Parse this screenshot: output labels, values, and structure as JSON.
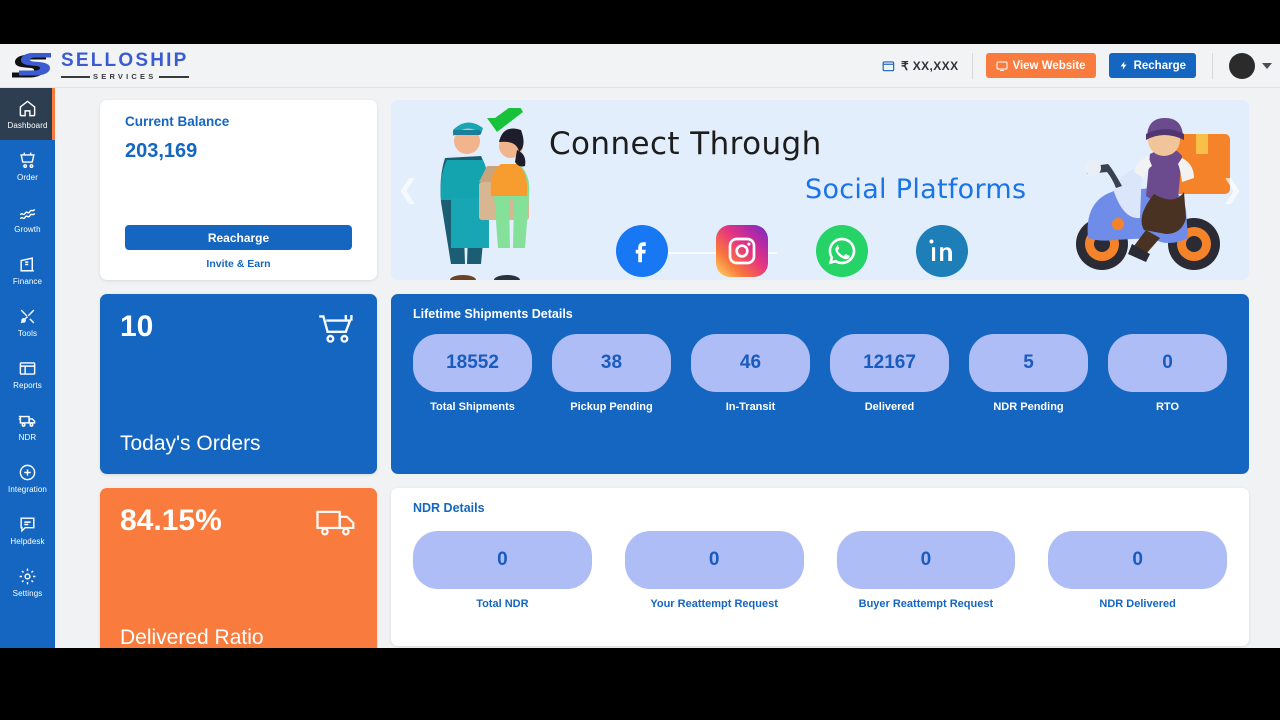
{
  "header": {
    "logo_name": "SELLOSHIP",
    "logo_sub": "SERVICES",
    "wallet_amount": "₹ XX,XXX",
    "view_website_label": "View Website",
    "recharge_label": "Recharge"
  },
  "sidebar": {
    "items": [
      {
        "label": "Dashboard",
        "icon": "home-icon",
        "active": true
      },
      {
        "label": "Order",
        "icon": "cart-icon",
        "active": false
      },
      {
        "label": "Growth",
        "icon": "growth-icon",
        "active": false
      },
      {
        "label": "Finance",
        "icon": "finance-icon",
        "active": false
      },
      {
        "label": "Tools",
        "icon": "tools-icon",
        "active": false
      },
      {
        "label": "Reports",
        "icon": "reports-icon",
        "active": false
      },
      {
        "label": "NDR",
        "icon": "truck-icon",
        "active": false
      },
      {
        "label": "Integration",
        "icon": "plus-circle-icon",
        "active": false
      },
      {
        "label": "Helpdesk",
        "icon": "chat-icon",
        "active": false
      },
      {
        "label": "Settings",
        "icon": "gear-icon",
        "active": false
      }
    ]
  },
  "balance": {
    "title": "Current Balance",
    "amount": "203,169",
    "recharge_label": "Reacharge",
    "invite_label": "Invite & Earn"
  },
  "banner": {
    "title": "Connect Through",
    "subtitle": "Social Platforms",
    "prev_icon": "chevron-left-icon",
    "next_icon": "chevron-right-icon",
    "socials": [
      "facebook-icon",
      "instagram-icon",
      "whatsapp-icon",
      "linkedin-icon"
    ]
  },
  "todays_orders": {
    "value": "10",
    "label": "Today's Orders",
    "icon": "cart-icon"
  },
  "delivered_ratio": {
    "value": "84.15%",
    "label": "Delivered Ratio",
    "icon": "truck-icon"
  },
  "lifetime_shipments": {
    "title": "Lifetime Shipments Details",
    "stats": [
      {
        "value": "18552",
        "label": "Total Shipments"
      },
      {
        "value": "38",
        "label": "Pickup Pending"
      },
      {
        "value": "46",
        "label": "In-Transit"
      },
      {
        "value": "12167",
        "label": "Delivered"
      },
      {
        "value": "5",
        "label": "NDR Pending"
      },
      {
        "value": "0",
        "label": "RTO"
      }
    ]
  },
  "ndr_details": {
    "title": "NDR Details",
    "stats": [
      {
        "value": "0",
        "label": "Total NDR"
      },
      {
        "value": "0",
        "label": "Your Reattempt Request"
      },
      {
        "value": "0",
        "label": "Buyer Reattempt Request"
      },
      {
        "value": "0",
        "label": "NDR Delivered"
      }
    ]
  },
  "colors": {
    "primary_blue": "#1566c0",
    "accent_orange": "#f97b3d",
    "pill_lavender": "#aebdf5",
    "sidebar_active": "#2c3e50",
    "banner_bg": "#e2eefc"
  }
}
